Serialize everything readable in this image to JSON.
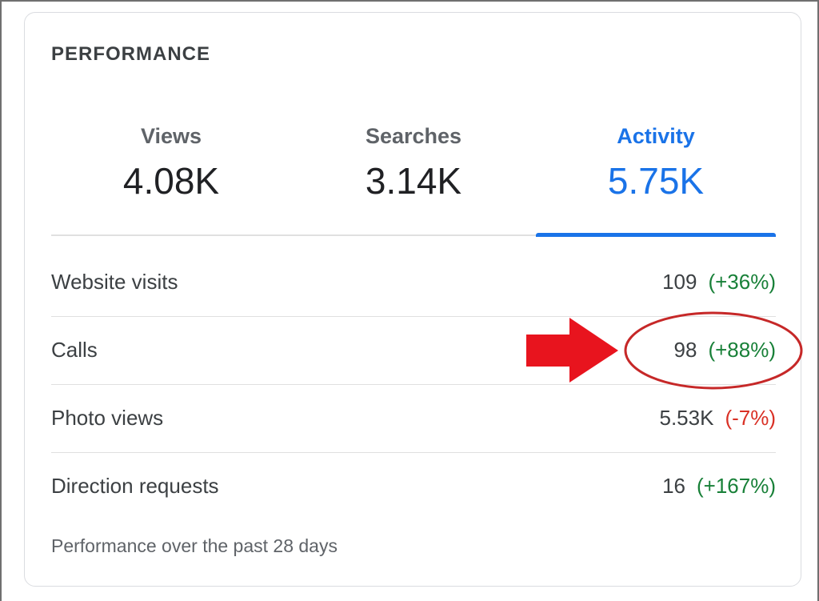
{
  "card": {
    "title": "PERFORMANCE"
  },
  "tabs": [
    {
      "label": "Views",
      "value": "4.08K",
      "active": false
    },
    {
      "label": "Searches",
      "value": "3.14K",
      "active": false
    },
    {
      "label": "Activity",
      "value": "5.75K",
      "active": true
    }
  ],
  "rows": [
    {
      "label": "Website visits",
      "value": "109",
      "change": "(+36%)",
      "trend": "up"
    },
    {
      "label": "Calls",
      "value": "98",
      "change": "(+88%)",
      "trend": "up",
      "highlighted": true
    },
    {
      "label": "Photo views",
      "value": "5.53K",
      "change": "(-7%)",
      "trend": "down"
    },
    {
      "label": "Direction requests",
      "value": "16",
      "change": "(+167%)",
      "trend": "up"
    }
  ],
  "footer": {
    "note": "Performance over the past 28 days"
  },
  "colors": {
    "accent": "#1a73e8",
    "positive": "#188038",
    "negative": "#d93025",
    "annotation": "#e8141e"
  },
  "annotation": {
    "arrow_icon": "arrow-right-icon",
    "highlight_shape": "ellipse",
    "target_row": "Calls"
  }
}
